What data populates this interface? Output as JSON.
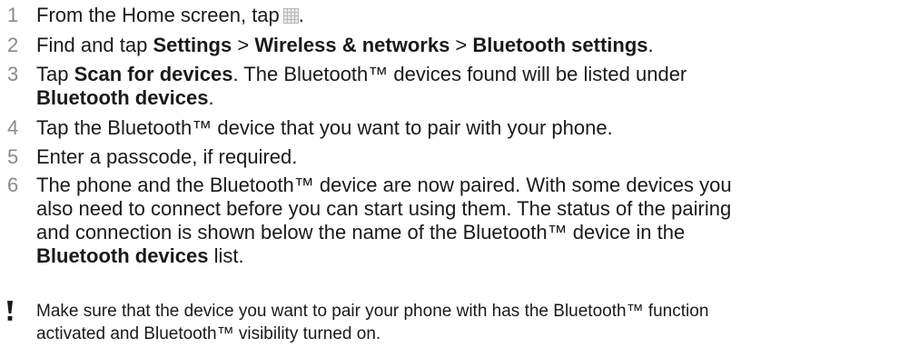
{
  "steps": [
    {
      "number": "1",
      "before_icon": "From the Home screen, tap",
      "icon": "apps-grid-icon",
      "after_icon": "."
    },
    {
      "number": "2",
      "text_a": "Find and tap ",
      "settings": "Settings",
      "sep1": " > ",
      "wireless": "Wireless & networks",
      "sep2": " > ",
      "bt_settings": "Bluetooth settings",
      "end": "."
    },
    {
      "number": "3",
      "text_a": "Tap ",
      "scan": "Scan for devices",
      "text_b": ". The Bluetooth™ devices found will be listed under",
      "bt_devices": "Bluetooth devices",
      "end": "."
    },
    {
      "number": "4",
      "text": "Tap the Bluetooth™ device that you want to pair with your phone."
    },
    {
      "number": "5",
      "text": "Enter a passcode, if required."
    },
    {
      "number": "6",
      "line1": "The phone and the Bluetooth™ device are now paired. With some devices you",
      "line2": "also need to connect before you can start using them. The status of the pairing",
      "line3": "and connection is shown below the name of the Bluetooth™ device in the",
      "bt_devices": "Bluetooth devices",
      "end": " list."
    }
  ],
  "note": {
    "icon": "exclamation-icon",
    "line1": "Make sure that the device you want to pair your phone with has the Bluetooth™ function",
    "line2": "activated and Bluetooth™ visibility turned on."
  }
}
